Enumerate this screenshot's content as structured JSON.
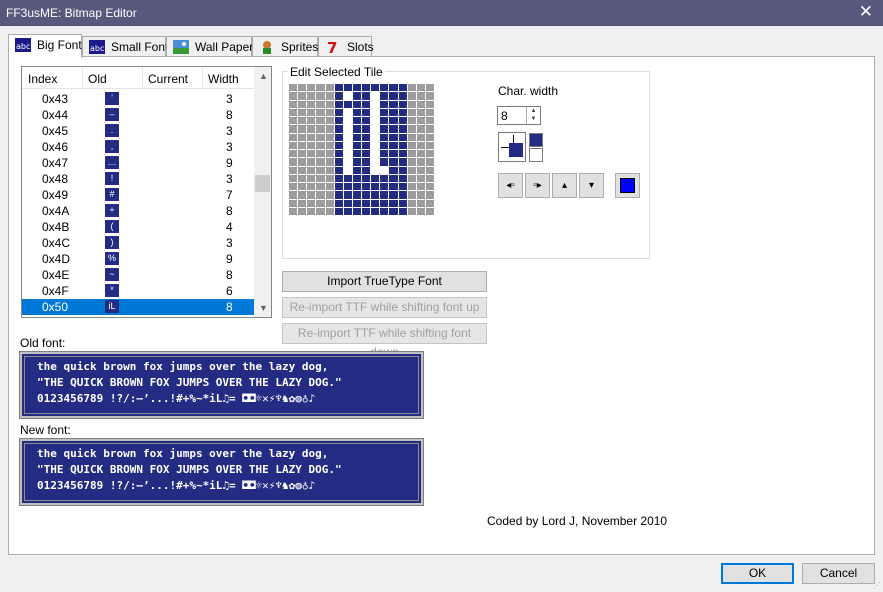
{
  "window": {
    "title": "FF3usME: Bitmap Editor",
    "close_label": "✕"
  },
  "tabs": [
    {
      "label": "Big Font",
      "icon": "abc-font-icon"
    },
    {
      "label": "Small Font",
      "icon": "abc-font-icon"
    },
    {
      "label": "Wall Paper",
      "icon": "landscape-icon"
    },
    {
      "label": "Sprites",
      "icon": "character-sprite-icon"
    },
    {
      "label": "Slots",
      "icon": "slot-seven-icon"
    }
  ],
  "list": {
    "headers": {
      "index": "Index",
      "old": "Old",
      "current": "Current",
      "width": "Width"
    },
    "rows": [
      {
        "index": "0x43",
        "glyph": "’",
        "width": "3"
      },
      {
        "index": "0x44",
        "glyph": "–",
        "width": "8"
      },
      {
        "index": "0x45",
        "glyph": ".",
        "width": "3"
      },
      {
        "index": "0x46",
        "glyph": ",",
        "width": "3"
      },
      {
        "index": "0x47",
        "glyph": "…",
        "width": "9"
      },
      {
        "index": "0x48",
        "glyph": "!",
        "width": "3"
      },
      {
        "index": "0x49",
        "glyph": "#",
        "width": "7"
      },
      {
        "index": "0x4A",
        "glyph": "+",
        "width": "8"
      },
      {
        "index": "0x4B",
        "glyph": "(",
        "width": "4"
      },
      {
        "index": "0x4C",
        "glyph": ")",
        "width": "3"
      },
      {
        "index": "0x4D",
        "glyph": "%",
        "width": "9"
      },
      {
        "index": "0x4E",
        "glyph": "~",
        "width": "8"
      },
      {
        "index": "0x4F",
        "glyph": "*",
        "width": "6"
      },
      {
        "index": "0x50",
        "glyph": "iL",
        "width": "8"
      }
    ],
    "selected_index": "0x50"
  },
  "editor": {
    "legend": "Edit Selected Tile",
    "char_width_label": "Char. width",
    "char_width_value": "8",
    "colors": {
      "foreground": "#232c82",
      "background": "#ffffff",
      "transparent": "#9d9d9d",
      "swatch": "#0000ff"
    }
  },
  "buttons": {
    "import_ttf": "Import TrueType Font",
    "reimport_up": "Re-import TTF while shifting font up",
    "reimport_down": "Re-import TTF while shifting font down",
    "ok": "OK",
    "cancel": "Cancel"
  },
  "old_font": {
    "label": "Old font:",
    "lines": [
      "the quick brown fox jumps over the lazy dog,",
      "\"THE QUICK BROWN FOX JUMPS OVER THE LAZY DOG.\"",
      "0123456789 !?/:–’...!#+%~*iL♫= ◘◘☼✕⚡♆♞✿◍♁♪"
    ]
  },
  "new_font": {
    "label": "New font:",
    "lines": [
      "the quick brown fox jumps over the lazy dog,",
      "\"THE QUICK BROWN FOX JUMPS OVER THE LAZY DOG.\"",
      "0123456789 !?/:–’...!#+%~*iL♫= ◘◘☼✕⚡♆♞✿◍♁♪"
    ]
  },
  "credit": "Coded by Lord J, November 2010"
}
